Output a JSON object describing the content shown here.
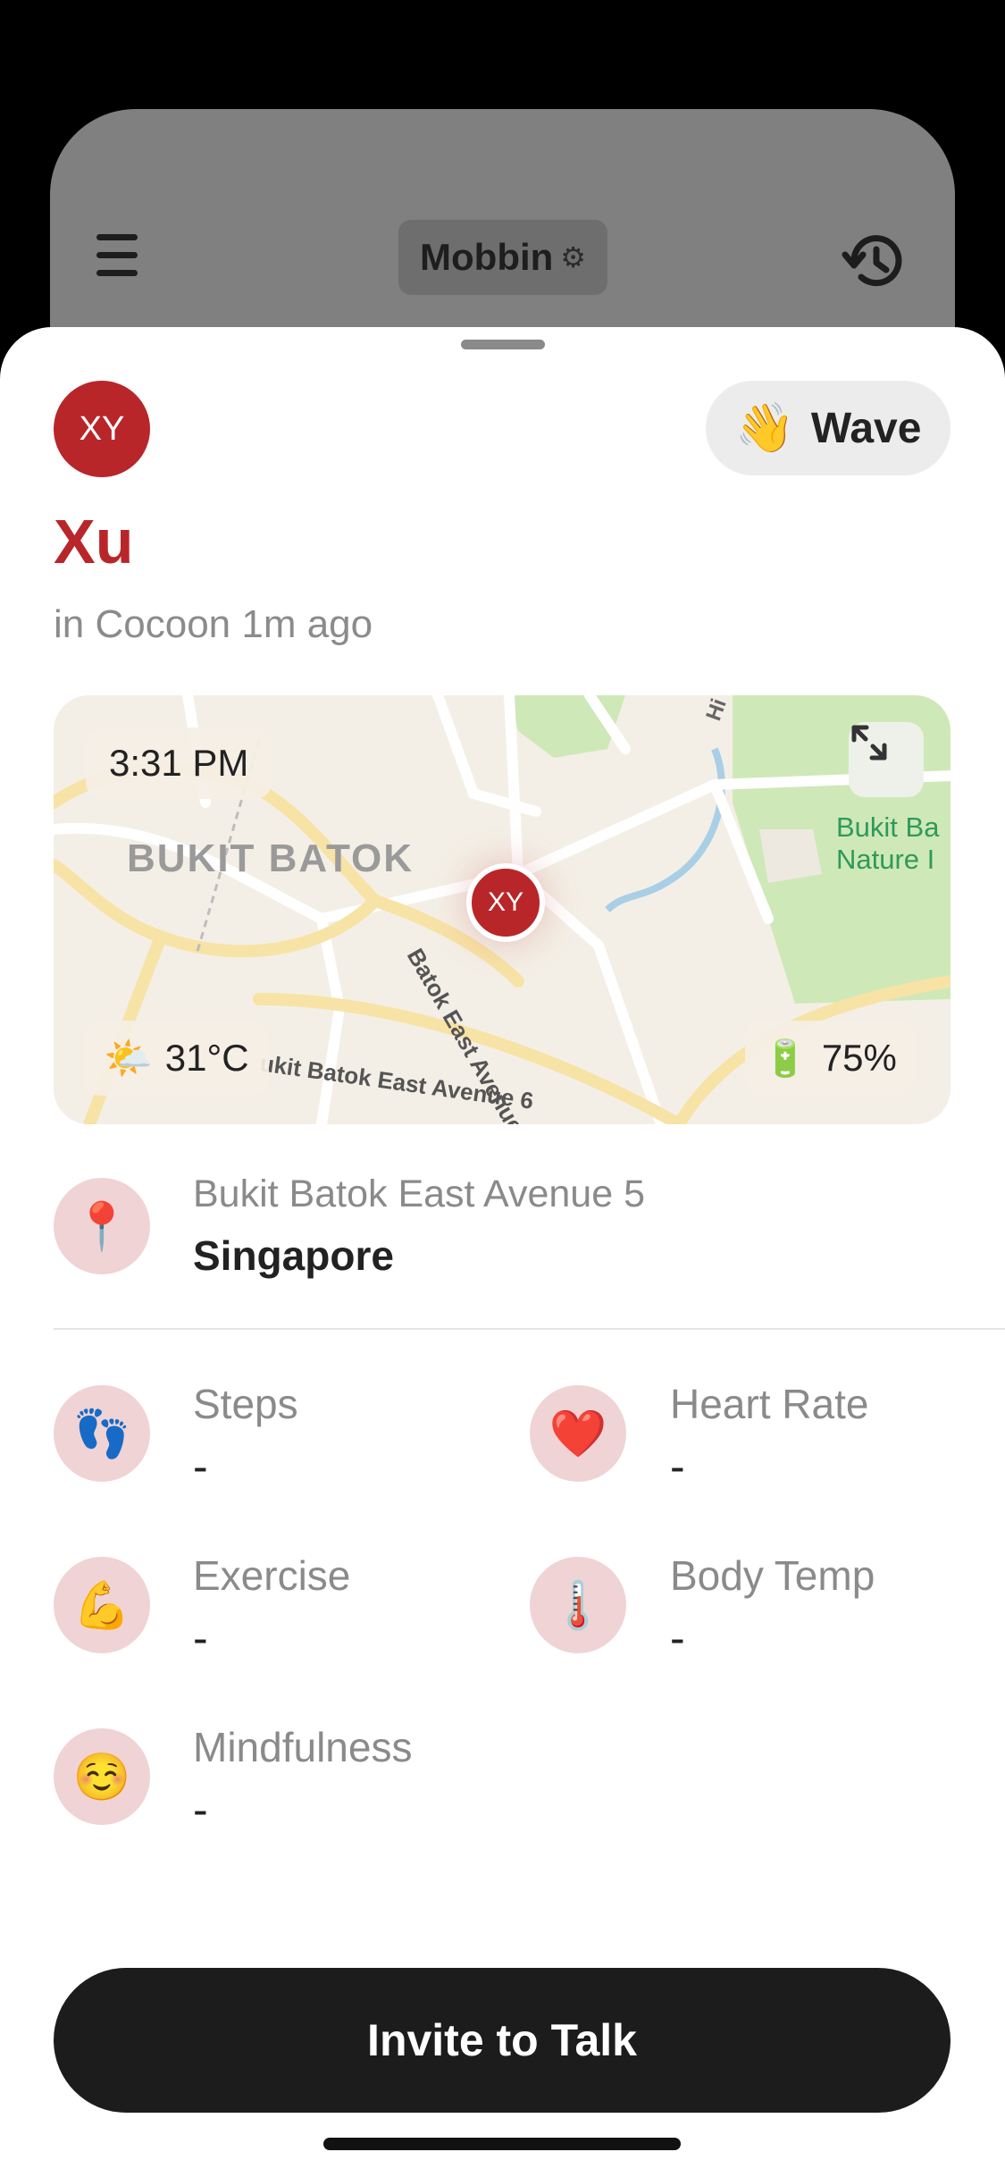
{
  "header": {
    "space_name": "Mobbin",
    "menu_icon": "hamburger-menu-icon",
    "settings_icon": "gear-icon",
    "history_icon": "history-icon"
  },
  "profile": {
    "initials": "XY",
    "name": "Xu",
    "status": "in Cocoon 1m ago",
    "wave_label": "Wave",
    "wave_emoji": "👋"
  },
  "map": {
    "time": "3:31 PM",
    "area_label": "BUKIT BATOK",
    "park_label_line1": "Bukit Ba",
    "park_label_line2": "Nature I",
    "street_label_1": "Batok East Avenue",
    "street_label_2": "ukit Batok East Avenue 6",
    "street_label_3": "Hi",
    "pin_initials": "XY",
    "weather_emoji": "🌤️",
    "temperature": "31°C",
    "battery_emoji": "🔋",
    "battery": "75%"
  },
  "location": {
    "emoji": "📍",
    "street": "Bukit Batok East Avenue 5",
    "country": "Singapore"
  },
  "stats": [
    {
      "label": "Steps",
      "value": "-",
      "emoji": "👣"
    },
    {
      "label": "Heart Rate",
      "value": "-",
      "emoji": "❤️"
    },
    {
      "label": "Exercise",
      "value": "-",
      "emoji": "💪"
    },
    {
      "label": "Body Temp",
      "value": "-",
      "emoji": "🌡️"
    },
    {
      "label": "Mindfulness",
      "value": "-",
      "emoji": "☺️"
    }
  ],
  "actions": {
    "invite_label": "Invite to Talk"
  },
  "colors": {
    "accent": "#b8262a",
    "icon_bg": "#f0d3d4",
    "button_bg": "#1c1c1c"
  }
}
